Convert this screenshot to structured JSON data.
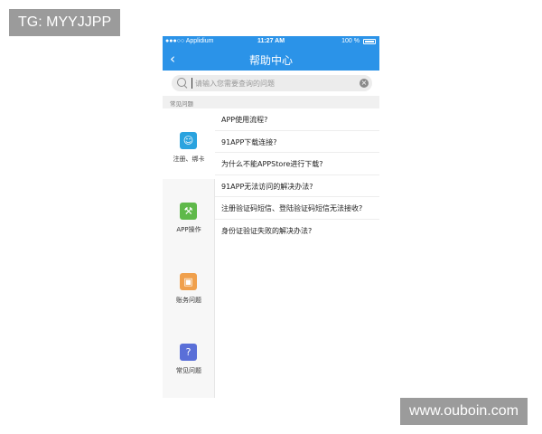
{
  "watermarks": {
    "top_left": "TG: MYYJJPP",
    "bottom_right": "www.ouboin.com"
  },
  "status_bar": {
    "carrier": "●●●○○ Applidium",
    "time": "11:27 AM",
    "battery": "100 %"
  },
  "nav": {
    "back_icon": "chevron-left-icon",
    "title": "帮助中心"
  },
  "search": {
    "placeholder": "请输入您需要查询的问题",
    "value": ""
  },
  "section_header": "常见问题",
  "categories": [
    {
      "label": "注册、绑卡",
      "icon": "user-card-icon",
      "color": "#2aa3df"
    },
    {
      "label": "APP操作",
      "icon": "wrench-icon",
      "color": "#5fb94a"
    },
    {
      "label": "账务问题",
      "icon": "wallet-icon",
      "color": "#f0a04c"
    },
    {
      "label": "常见问题",
      "icon": "question-icon",
      "color": "#5a6fd8"
    }
  ],
  "questions": [
    "APP使用流程?",
    "91APP下载连接?",
    "为什么不能APPStore进行下载?",
    "91APP无法访问的解决办法?",
    "注册验证码短信、登陆验证码短信无法接收?",
    "身份证验证失败的解决办法?"
  ],
  "colors": {
    "nav_bg": "#2b93e8",
    "list_bg": "#f7f7f7"
  }
}
